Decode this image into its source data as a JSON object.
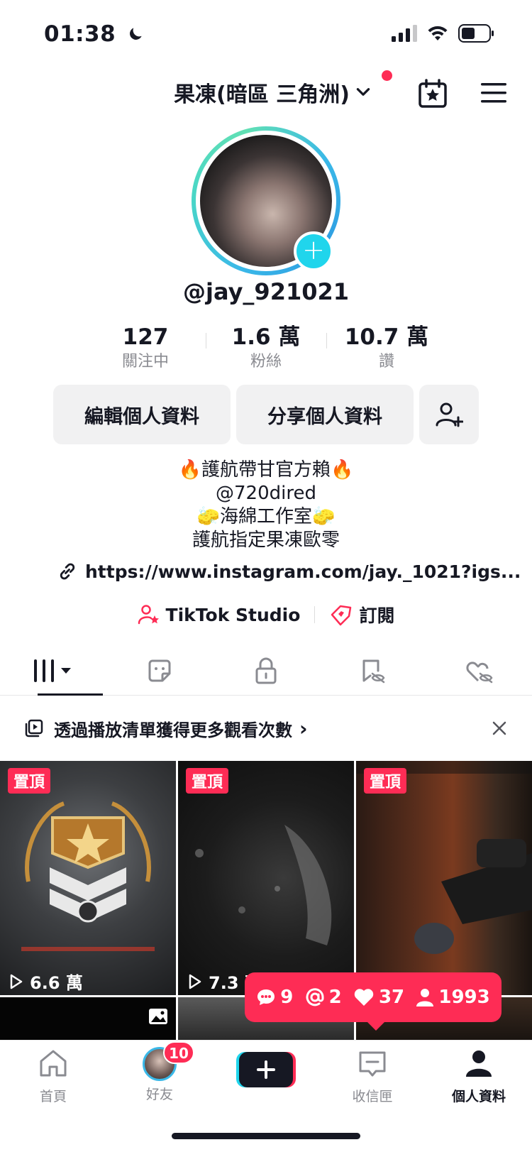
{
  "status_bar": {
    "time": "01:38"
  },
  "header": {
    "title": "果凍(暗區 三角洲)"
  },
  "profile": {
    "username": "@jay_921021",
    "stats": [
      {
        "value": "127",
        "label": "關注中"
      },
      {
        "value": "1.6 萬",
        "label": "粉絲"
      },
      {
        "value": "10.7 萬",
        "label": "讚"
      }
    ],
    "edit_button": "編輯個人資料",
    "share_button": "分享個人資料",
    "bio_lines": [
      "🔥護航帶甘官方賴🔥",
      "@720dired",
      "🧽海綿工作室🧽",
      "護航指定果凍歐零"
    ],
    "link": "https://www.instagram.com/jay._1021?igs...",
    "studio_label": "TikTok Studio",
    "subscribe_label": "訂閱"
  },
  "banner": {
    "text": "透過播放清單獲得更多觀看次數",
    "chevron": "›"
  },
  "videos": [
    {
      "pin": "置頂",
      "views": "6.6 萬"
    },
    {
      "pin": "置頂",
      "views": "7.3 萬"
    },
    {
      "pin": "置頂",
      "views": ""
    }
  ],
  "notifications": {
    "comments": "9",
    "mentions": "2",
    "likes": "37",
    "followers": "1993"
  },
  "bottom_nav": {
    "home": "首頁",
    "friends": "好友",
    "friends_badge": "10",
    "inbox": "收信匣",
    "profile": "個人資料"
  },
  "colors": {
    "accent": "#fe2c55",
    "cyan": "#20d5ec",
    "text": "#161823"
  }
}
